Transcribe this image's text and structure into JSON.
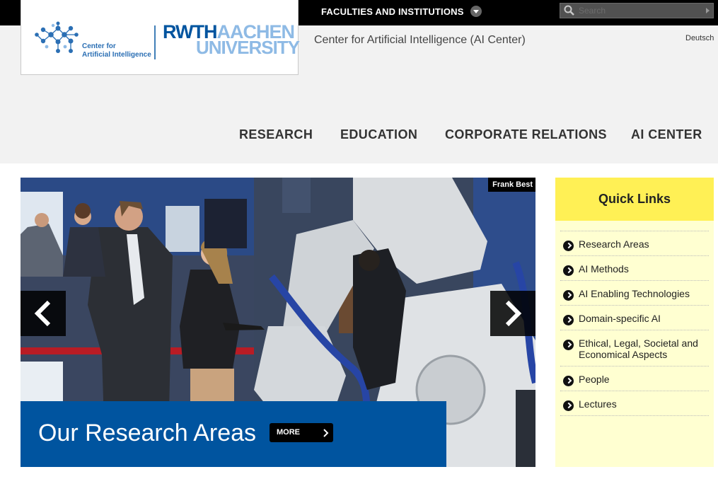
{
  "header": {
    "faculties_label": "FACULTIES AND INSTITUTIONS",
    "search_placeholder": "Search",
    "site_title": "Center for Artificial Intelligence (AI Center)",
    "language_link": "Deutsch"
  },
  "logo": {
    "center_line1": "Center for",
    "center_line2": "Artificial Intelligence",
    "rwth": "RWTH",
    "aachen": "AACHEN",
    "university": "UNIVERSITY"
  },
  "nav": {
    "items": [
      "RESEARCH",
      "EDUCATION",
      "CORPORATE RELATIONS",
      "AI CENTER"
    ]
  },
  "slider": {
    "photo_credit": "Frank Best",
    "caption": "Our Research Areas",
    "more_label": "MORE",
    "prev_icon": "chevron-left-icon",
    "next_icon": "chevron-right-icon"
  },
  "quick_links": {
    "title": "Quick Links",
    "items": [
      {
        "label": "Research Areas"
      },
      {
        "label": "AI Methods"
      },
      {
        "label": "AI Enabling Technologies"
      },
      {
        "label": "Domain-specific AI"
      },
      {
        "label": "Ethical, Legal, Societal and Economical Aspects"
      },
      {
        "label": "People"
      },
      {
        "label": "Lectures"
      }
    ]
  },
  "colors": {
    "rwth_blue": "#00549f",
    "rwth_light_blue": "#8ebae5",
    "quick_links_header": "#fff055",
    "quick_links_bg": "#ffffd1"
  }
}
